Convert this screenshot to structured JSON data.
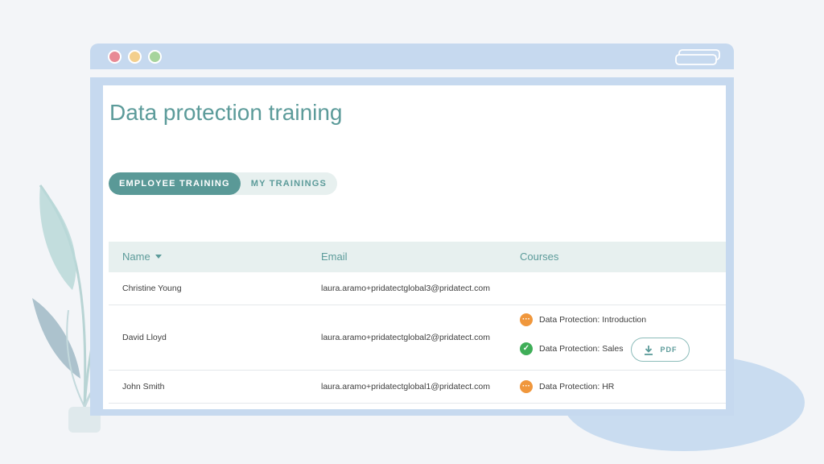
{
  "page": {
    "title": "Data protection training"
  },
  "tabs": [
    {
      "label": "EMPLOYEE TRAINING",
      "active": true
    },
    {
      "label": "MY TRAININGS",
      "active": false
    }
  ],
  "table": {
    "columns": {
      "name": "Name",
      "email": "Email",
      "courses": "Courses"
    },
    "rows": [
      {
        "name": "Christine Young",
        "email": "laura.aramo+pridatectglobal3@pridatect.com",
        "courses": []
      },
      {
        "name": "David Lloyd",
        "email": "laura.aramo+pridatectglobal2@pridatect.com",
        "courses": [
          {
            "title": "Data Protection: Introduction",
            "status": "in-progress"
          },
          {
            "title": "Data Protection: Sales",
            "status": "completed",
            "download": "PDF"
          }
        ]
      },
      {
        "name": "John Smith",
        "email": "laura.aramo+pridatectglobal1@pridatect.com",
        "courses": [
          {
            "title": "Data Protection: HR",
            "status": "in-progress"
          }
        ]
      }
    ]
  },
  "icons": {
    "in_progress": "ellipsis-icon",
    "completed": "check-icon",
    "download": "download-icon",
    "sort": "caret-down-icon"
  },
  "colors": {
    "accent": "#5a9997",
    "in_progress": "#f0973c",
    "completed": "#3fae58",
    "window_frame": "#c6d9ef"
  }
}
